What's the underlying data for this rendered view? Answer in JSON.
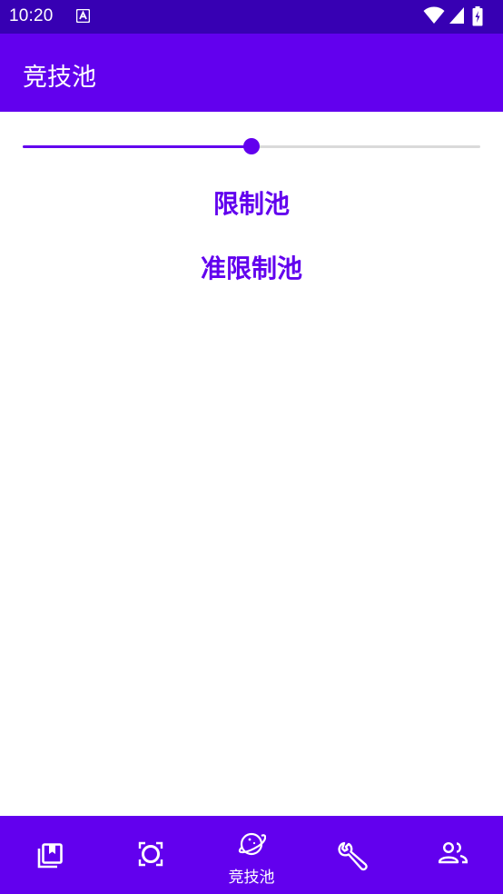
{
  "status_bar": {
    "time": "10:20"
  },
  "app_bar": {
    "title": "竞技池"
  },
  "slider": {
    "value": 0.5
  },
  "pools": [
    {
      "label": "限制池"
    },
    {
      "label": "准限制池"
    }
  ],
  "bottom_nav": {
    "items": [
      {
        "icon": "library-bookmark-icon"
      },
      {
        "icon": "card-scan-icon"
      },
      {
        "icon": "planet-icon",
        "label": "竞技池",
        "active": true
      },
      {
        "icon": "wrench-icon"
      },
      {
        "icon": "people-icon"
      }
    ]
  },
  "colors": {
    "status_bar": "#3700b3",
    "primary": "#6200ee",
    "track_inactive": "#dadada"
  }
}
